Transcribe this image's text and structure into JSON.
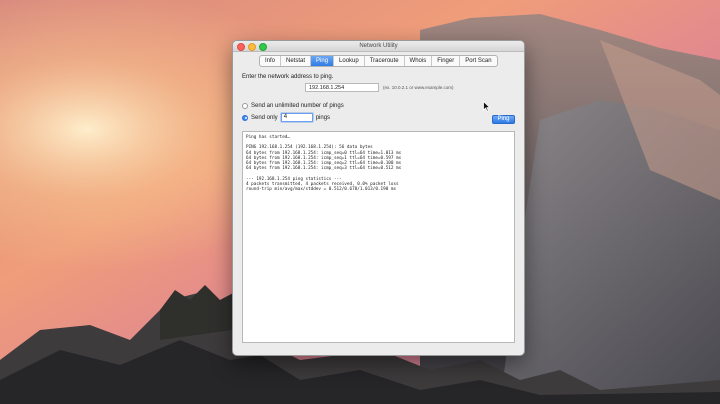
{
  "window": {
    "title": "Network Utility"
  },
  "tabs": [
    {
      "label": "Info",
      "active": false
    },
    {
      "label": "Netstat",
      "active": false
    },
    {
      "label": "Ping",
      "active": true
    },
    {
      "label": "Lookup",
      "active": false
    },
    {
      "label": "Traceroute",
      "active": false
    },
    {
      "label": "Whois",
      "active": false
    },
    {
      "label": "Finger",
      "active": false
    },
    {
      "label": "Port Scan",
      "active": false
    }
  ],
  "ping": {
    "address_label": "Enter the network address to ping.",
    "address_value": "192.168.1.254",
    "address_hint": "(ex. 10.0.2.1 or www.example.com)",
    "unlimited_label": "Send an unlimited number of pings",
    "send_only_label": "Send only",
    "count_value": "4",
    "pings_label": "pings",
    "button_label": "Ping",
    "send_only_selected": true
  },
  "output": {
    "lines": [
      "Ping has started…",
      "",
      "PING 192.168.1.254 (192.168.1.254): 56 data bytes",
      "64 bytes from 192.168.1.254: icmp_seq=0 ttl=64 time=1.013 ms",
      "64 bytes from 192.168.1.254: icmp_seq=1 ttl=64 time=0.597 ms",
      "64 bytes from 192.168.1.254: icmp_seq=2 ttl=64 time=0.100 ms",
      "64 bytes from 192.168.1.254: icmp_seq=3 ttl=64 time=0.512 ms",
      "",
      "--- 192.168.1.254 ping statistics ---",
      "4 packets transmitted, 4 packets received, 0.0% packet loss",
      "round-trip min/avg/max/stddev = 0.512/0.678/1.013/0.190 ms"
    ]
  },
  "colors": {
    "accent": "#2f7be6",
    "close": "#fc605c",
    "minimize": "#fdbc40",
    "zoom": "#34c84a"
  }
}
